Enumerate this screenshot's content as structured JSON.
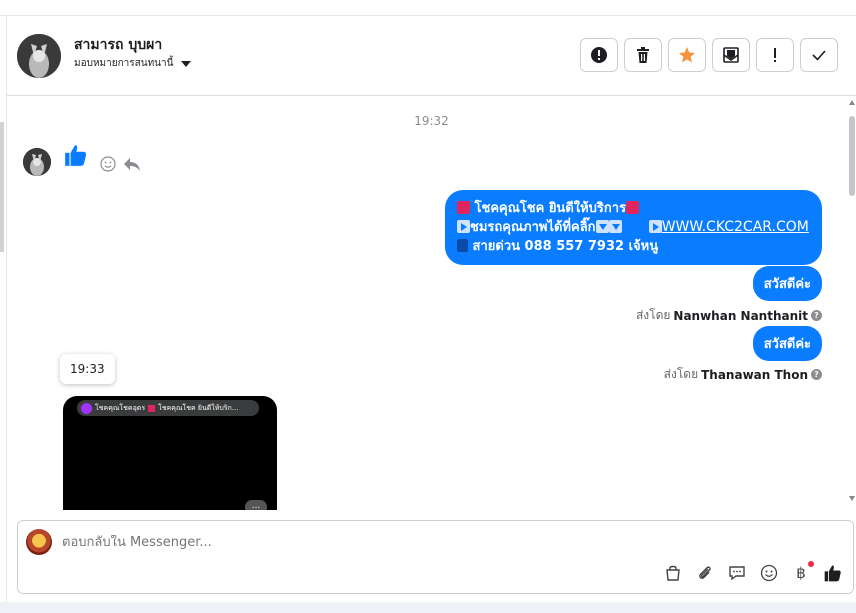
{
  "header": {
    "contact_name": "สามารถ บุบผา",
    "assign_label": "มอบหมายการสนทนานี้",
    "actions": [
      {
        "name": "spam-button",
        "icon": "alert-circle-icon"
      },
      {
        "name": "delete-button",
        "icon": "trash-icon"
      },
      {
        "name": "star-button",
        "icon": "star-icon"
      },
      {
        "name": "mark-unread-button",
        "icon": "mail-icon"
      },
      {
        "name": "follow-up-button",
        "icon": "exclamation-icon"
      },
      {
        "name": "done-button",
        "icon": "check-icon"
      }
    ]
  },
  "conversation": {
    "timestamp_1": "19:32",
    "big_message": {
      "line1": "โชคคุณโชค ยินดีให้บริการ",
      "line2_text": "ชมรถคุณภาพได้ที่คลิ๊ก",
      "link": "WWW.CKC2CAR.COM",
      "line3": "สายด่วน 088 557 7932 เจ้หนู"
    },
    "reply_1": "สวัสดีค่ะ",
    "sent_by_prefix": "ส่งโดย",
    "sender_1": "Nanwhan Nanthanit",
    "reply_2": "สวัสดีค่ะ",
    "sender_2": "Thanawan Thon",
    "tooltip_time": "19:33",
    "video_preview": {
      "title": "โชคคุณโชคอุดร",
      "snippet": "โชคคุณโชค ยินดีให้บริก...",
      "more": "..."
    }
  },
  "composer": {
    "placeholder": "ตอบกลับใน Messenger...",
    "tools": [
      "bag-icon",
      "attachment-icon",
      "comment-icon",
      "emoji-icon",
      "baht-icon",
      "like-icon"
    ]
  },
  "colors": {
    "accent": "#0a7cff",
    "star": "#f7923b"
  }
}
